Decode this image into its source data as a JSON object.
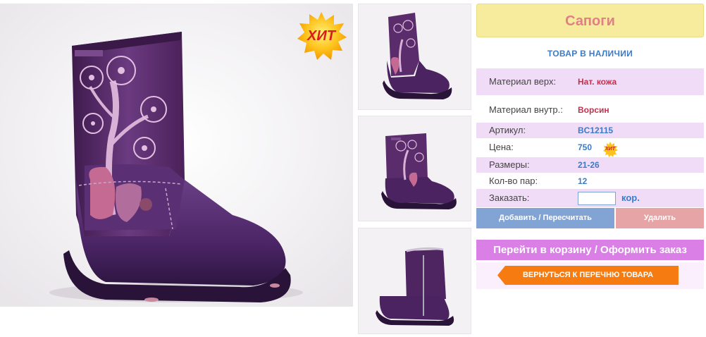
{
  "product": {
    "badge": "ХИТ",
    "title": "Сапоги",
    "stock_status": "ТОВАР В НАЛИЧИИ"
  },
  "specs": [
    {
      "label": "Материал верх:",
      "value": "Нат. кожа"
    },
    {
      "label": "Материал внутр.:",
      "value": "Ворсин"
    },
    {
      "label": "Артикул:",
      "value": "BC12115"
    },
    {
      "label": "Цена:",
      "value": "750"
    },
    {
      "label": "Размеры:",
      "value": "21-26"
    },
    {
      "label": "Кол-во пар:",
      "value": "12"
    }
  ],
  "price_badge": "ХИТ",
  "order": {
    "label": "Заказать:",
    "quantity": "",
    "unit": "кор."
  },
  "buttons": {
    "add": "Добавить / Пересчитать",
    "delete": "Удалить",
    "cart": "Перейти в корзину / Оформить заказ",
    "back": "ВЕРНУТЬСЯ К ПЕРЕЧНЮ ТОВАРА"
  },
  "colors": {
    "title_bg": "#f7ec9d",
    "title_text": "#e07f84",
    "row_highlight": "#f1dcf8",
    "link_blue": "#3b7bc7",
    "value_red": "#c2324e",
    "add_button": "#82a4d4",
    "delete_button": "#e7a4a6",
    "cart_button": "#d97fe6",
    "back_button": "#f67c12",
    "boot_purple": "#5a2c6b"
  }
}
